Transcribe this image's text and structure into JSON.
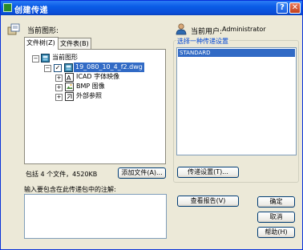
{
  "window": {
    "title": "创建传递",
    "help_glyph": "?",
    "close_glyph": "✕"
  },
  "left": {
    "current_drawing_label": "当前图形:",
    "tabs": [
      {
        "label": "文件树(Z)"
      },
      {
        "label": "文件表(B)"
      }
    ],
    "tree": {
      "root": {
        "label": "当前图形",
        "expander": "−"
      },
      "file": {
        "label": "19_080_10_4_f2.dwg",
        "expander": "−",
        "checked": "✓"
      },
      "children": [
        {
          "label": "ICAD 字体映像",
          "expander": "+"
        },
        {
          "label": "BMP 图像",
          "expander": "+"
        },
        {
          "label": "外部参照",
          "expander": "+"
        }
      ]
    },
    "file_count_text": "包括 4 个文件，4520KB",
    "add_file_button": "添加文件(A)...",
    "notes_label": "输入要包含在此传递包中的注解:",
    "notes_value": ""
  },
  "right": {
    "current_user_label": "当前用户:",
    "current_user_value": "Administrator",
    "setup_group_label": "选择一种传递设置",
    "setups": [
      {
        "label": "STANDARD",
        "selected": true
      }
    ],
    "transmittal_setups_button": "传递设置(T)...",
    "view_report_button": "查看报告(V)",
    "ok_button": "确定",
    "cancel_button": "取消",
    "help_button": "帮助(H)"
  },
  "colors": {
    "selection": "#316ac5",
    "title_bar": "#0a5ce6",
    "face": "#ECE9D8"
  }
}
